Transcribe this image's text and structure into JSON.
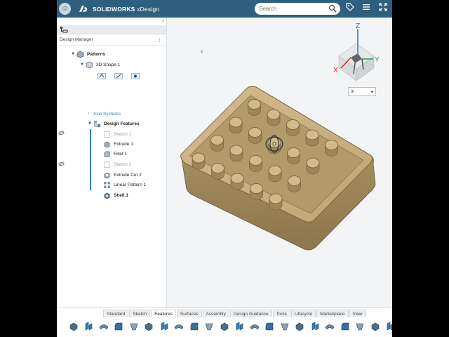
{
  "app": {
    "brand": "SOLIDWORKS",
    "product": "xDesign"
  },
  "search": {
    "placeholder": "Search"
  },
  "design_manager": {
    "label": "Design Manager"
  },
  "tree": [
    {
      "label": "Patterns",
      "style": "bold",
      "icon": "patterns-icon"
    },
    {
      "label": "3D Shape 1",
      "style": "",
      "icon": "shape-icon"
    },
    {
      "label": "Axis Systems",
      "style": "link",
      "icon": ""
    },
    {
      "label": "Design Features",
      "style": "bold",
      "icon": "features-icon"
    },
    {
      "label": "Sketch 1",
      "style": "dim",
      "icon": "sketch-icon"
    },
    {
      "label": "Extrude 1",
      "style": "",
      "icon": "extrude-icon"
    },
    {
      "label": "Fillet 1",
      "style": "",
      "icon": "fillet-icon"
    },
    {
      "label": "Sketch 2",
      "style": "dim",
      "icon": "sketch-icon"
    },
    {
      "label": "Extrude Cut 2",
      "style": "",
      "icon": "extrude-cut-icon"
    },
    {
      "label": "Linear Pattern 1",
      "style": "",
      "icon": "linear-pattern-icon"
    },
    {
      "label": "Shell.1",
      "style": "bold",
      "icon": "shell-icon"
    }
  ],
  "viewport": {
    "unit": "in"
  },
  "triad": {
    "x": "X",
    "y": "Y",
    "z": "Z"
  },
  "bottom_tabs": [
    "Standard",
    "Sketch",
    "Features",
    "Surfaces",
    "Assembly",
    "Design Guidance",
    "Tools",
    "Lifecycle",
    "Marketplace",
    "View"
  ],
  "active_tab": "Features",
  "colors": {
    "topbar": "#2f5f7e",
    "model": "#c8ac7a",
    "accent": "#2b7cc9"
  }
}
